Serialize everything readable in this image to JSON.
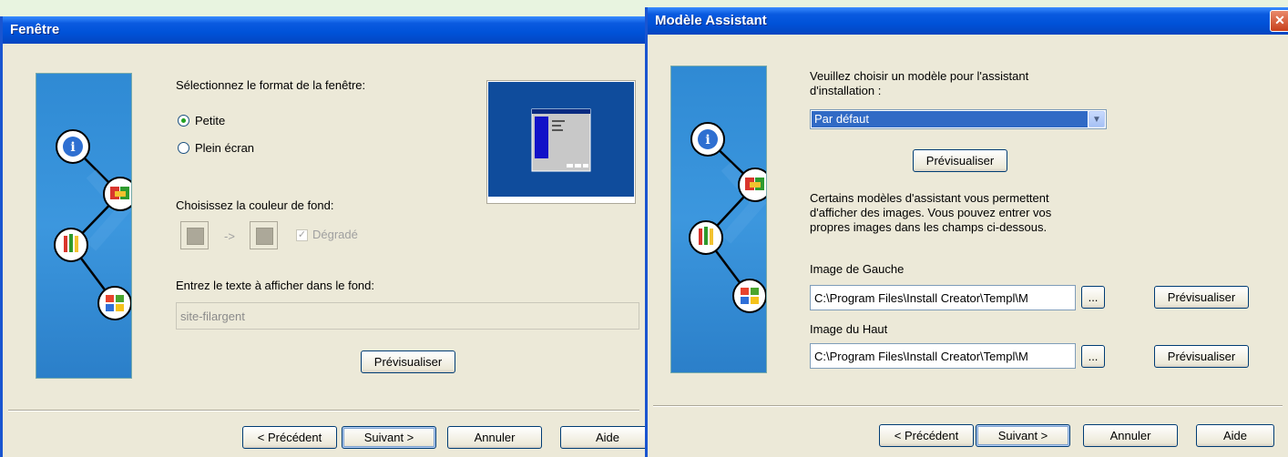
{
  "dialog1": {
    "title": "Fenêtre",
    "format_label": "Sélectionnez le format de la fenêtre:",
    "radio_small": "Petite",
    "radio_full": "Plein écran",
    "color_label": "Choisissez la couleur de fond:",
    "arrow": "->",
    "gradient_label": "Dégradé",
    "text_label": "Entrez le texte à afficher dans le fond:",
    "text_value": "site-filargent",
    "preview_button": "Prévisualiser",
    "back_button": "< Précédent",
    "next_button": "Suivant >",
    "cancel_button": "Annuler",
    "help_button": "Aide"
  },
  "dialog2": {
    "title": "Modèle Assistant",
    "close": "✕",
    "choose_label_1": "Veuillez choisir un modèle pour l'assistant",
    "choose_label_2": "d'installation :",
    "template_selected": "Par défaut",
    "preview_button": "Prévisualiser",
    "info_1": "Certains modèles d'assistant vous permettent",
    "info_2": "d'afficher des images. Vous pouvez entrer vos",
    "info_3": "propres images dans les champs ci-dessous.",
    "left_image_label": "Image de Gauche",
    "left_image_value": "C:\\Program Files\\Install Creator\\Templ\\M",
    "browse": "...",
    "left_preview": "Prévisualiser",
    "top_image_label": "Image du Haut",
    "top_image_value": "C:\\Program Files\\Install Creator\\Templ\\M",
    "top_preview": "Prévisualiser",
    "back_button": "< Précédent",
    "next_button": "Suivant >",
    "cancel_button": "Annuler",
    "help_button": "Aide"
  },
  "colors": {
    "titlebar": "#0052d8",
    "dialog_bg": "#ece9d8",
    "side_panel": "#3c97de",
    "selection": "#316ac5"
  },
  "icons": [
    "info-icon",
    "book-icon",
    "tools-icon",
    "windows-icon"
  ]
}
